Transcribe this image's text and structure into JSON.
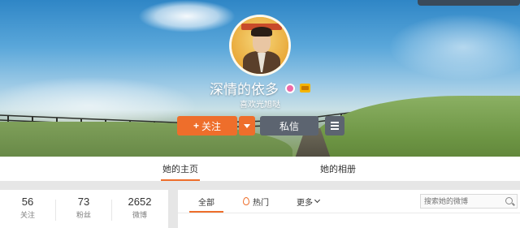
{
  "profile": {
    "name": "深情的依多",
    "subtitle": "喜欢光旭哒",
    "avatar_label": "profile-avatar"
  },
  "actions": {
    "follow_label": "关注",
    "follow_plus": "+",
    "message_label": "私信"
  },
  "tabs": [
    {
      "label": "她的主页",
      "active": true
    },
    {
      "label": "她的相册",
      "active": false
    }
  ],
  "stats": [
    {
      "value": "56",
      "label": "关注"
    },
    {
      "value": "73",
      "label": "粉丝"
    },
    {
      "value": "2652",
      "label": "微博"
    }
  ],
  "feed": {
    "all_label": "全部",
    "hot_label": "热门",
    "more_label": "更多",
    "search_placeholder": "搜索她的微博"
  },
  "colors": {
    "accent": "#ee6e2b",
    "secondary_button": "#5c6470",
    "page_bg": "#e6e6e6"
  },
  "icons": [
    "plus-icon",
    "chevron-down-icon",
    "menu-icon",
    "flame-icon",
    "search-icon",
    "vip-badge-icon",
    "member-badge-icon"
  ]
}
